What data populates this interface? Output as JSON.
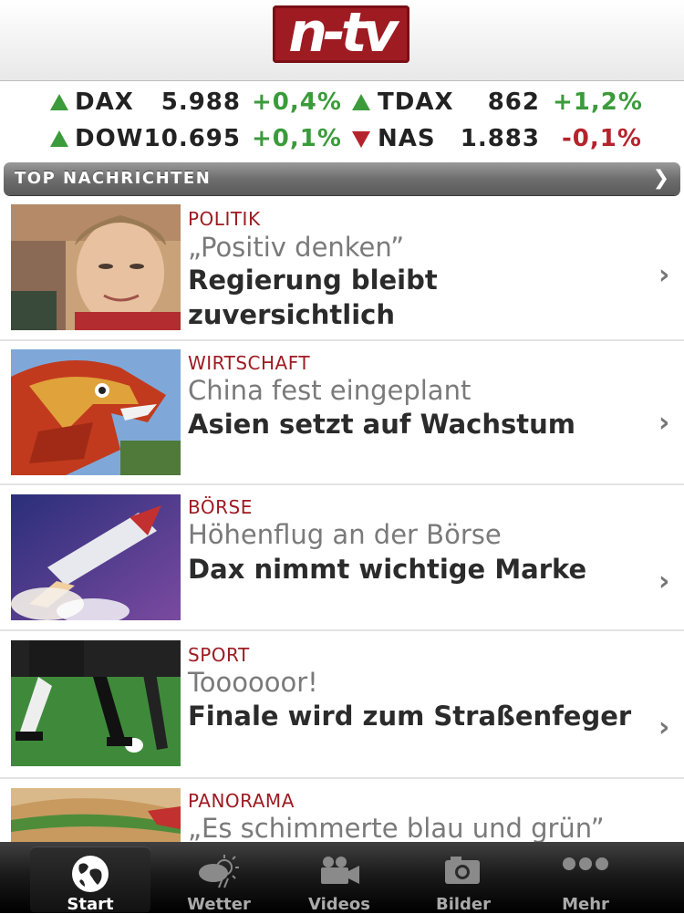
{
  "header": {
    "logo": "n-tv"
  },
  "ticker": [
    {
      "name": "DAX",
      "value": "5.988",
      "change": "+0,4%",
      "direction": "up"
    },
    {
      "name": "TDAX",
      "value": "862",
      "change": "+1,2%",
      "direction": "up"
    },
    {
      "name": "DOW",
      "value": "10.695",
      "change": "+0,1%",
      "direction": "up"
    },
    {
      "name": "NAS",
      "value": "1.883",
      "change": "-0,1%",
      "direction": "down"
    }
  ],
  "section": {
    "title": "TOP NACHRICHTEN"
  },
  "articles": [
    {
      "category": "POLITIK",
      "subtitle": "„Positiv denken”",
      "headline": "Regierung bleibt zuversichtlich"
    },
    {
      "category": "WIRTSCHAFT",
      "subtitle": "China fest eingeplant",
      "headline": "Asien setzt auf Wachstum"
    },
    {
      "category": "BÖRSE",
      "subtitle": "Höhenflug an der Börse",
      "headline": "Dax nimmt wichtige Marke"
    },
    {
      "category": "SPORT",
      "subtitle": "Toooooor!",
      "headline": "Finale wird zum Straßenfeger"
    },
    {
      "category": "PANORAMA",
      "subtitle": "„Es schimmerte blau und grün”",
      "headline": ""
    }
  ],
  "tabbar": [
    {
      "label": "Start",
      "icon": "globe-icon",
      "active": true
    },
    {
      "label": "Wetter",
      "icon": "weather-icon",
      "active": false
    },
    {
      "label": "Videos",
      "icon": "video-camera-icon",
      "active": false
    },
    {
      "label": "Bilder",
      "icon": "photo-camera-icon",
      "active": false
    },
    {
      "label": "Mehr",
      "icon": "more-dots-icon",
      "active": false
    }
  ],
  "colors": {
    "brand": "#9e1b22",
    "positive": "#3b9b3b",
    "negative": "#b5232d"
  }
}
